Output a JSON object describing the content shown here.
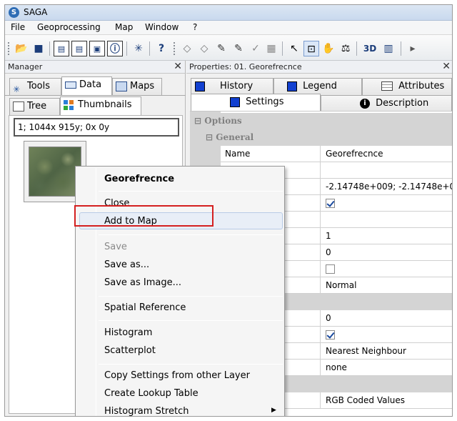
{
  "window": {
    "title": "SAGA"
  },
  "menubar": {
    "items": [
      "File",
      "Geoprocessing",
      "Map",
      "Window",
      "?"
    ]
  },
  "toolbar": {
    "buttons": [
      "open-icon",
      "save-icon",
      "tile-icon",
      "tile2-icon",
      "map-icon",
      "info-icon",
      "tool-icon",
      "help-icon",
      "diamond-icon",
      "diamond2-icon",
      "edit-icon",
      "edit2-icon",
      "check-icon",
      "layer-icon",
      "arrow-icon",
      "zoom-icon",
      "pan-icon",
      "measure-icon",
      "3d-icon",
      "histogram-icon"
    ],
    "three_d_label": "3D"
  },
  "manager": {
    "header": "Manager",
    "close": "✕",
    "tabs": [
      {
        "label": "Tools",
        "icon": "tools-icon"
      },
      {
        "label": "Data",
        "icon": "data-icon"
      },
      {
        "label": "Maps",
        "icon": "maps-icon"
      }
    ],
    "subtabs": [
      {
        "label": "Tree",
        "icon": "tree-icon"
      },
      {
        "label": "Thumbnails",
        "icon": "thumbnails-icon"
      }
    ],
    "info": "1; 1044x 915y; 0x 0y"
  },
  "properties": {
    "header": "Properties: 01. Georefrecnce",
    "close": "✕",
    "tabs_row1": [
      "History",
      "Legend",
      "Attributes"
    ],
    "tabs_row2": [
      "Settings",
      "Description"
    ],
    "group_options": "Options",
    "group_general": "General",
    "rows": [
      {
        "label": "Name",
        "value": "Georefrecnce"
      },
      {
        "label": "",
        "value": ""
      },
      {
        "label": "",
        "value": "-2.14748e+009; -2.14748e+00"
      },
      {
        "label": "d",
        "value": ""
      },
      {
        "label": "",
        "value": ""
      },
      {
        "label": "",
        "value": "1"
      },
      {
        "label": "",
        "value": "0"
      },
      {
        "label": "lues",
        "value": ""
      },
      {
        "label": "ndling",
        "value": "Normal"
      },
      {
        "label": "",
        "value": ""
      },
      {
        "label": "y [%]",
        "value": "0"
      },
      {
        "label": "cales",
        "value": ""
      },
      {
        "label": "",
        "value": "Nearest Neighbour"
      },
      {
        "label": "",
        "value": "none"
      },
      {
        "label": "",
        "value": ""
      },
      {
        "label": "",
        "value": "RGB Coded Values"
      }
    ]
  },
  "context_menu": {
    "title": "Georefrecnce",
    "items": [
      "Close",
      "Add to Map",
      "Save",
      "Save as...",
      "Save as Image...",
      "Spatial Reference",
      "Histogram",
      "Scatterplot",
      "Copy Settings from other Layer",
      "Create Lookup Table",
      "Histogram Stretch"
    ],
    "submenu_arrow": "▶"
  }
}
